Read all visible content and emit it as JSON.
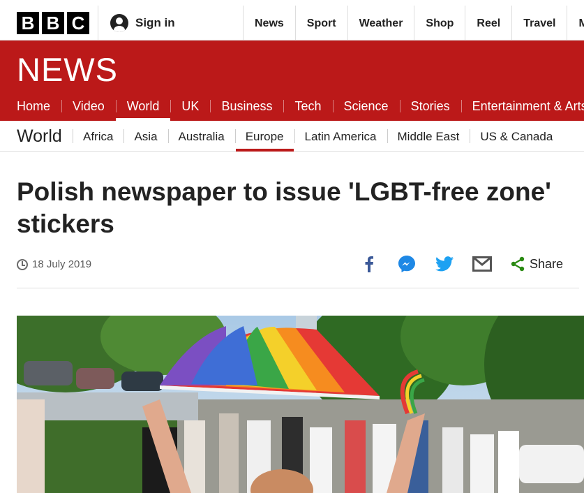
{
  "brand": {
    "logo_letters": [
      "B",
      "B",
      "C"
    ]
  },
  "account": {
    "sign_in_label": "Sign in"
  },
  "top_nav": [
    "News",
    "Sport",
    "Weather",
    "Shop",
    "Reel",
    "Travel",
    "Mo"
  ],
  "banner": {
    "title": "NEWS",
    "color": "#bb1919"
  },
  "main_nav": {
    "items": [
      "Home",
      "Video",
      "World",
      "UK",
      "Business",
      "Tech",
      "Science",
      "Stories",
      "Entertainment & Arts"
    ],
    "active": "World"
  },
  "sub_nav": {
    "section": "World",
    "items": [
      "Africa",
      "Asia",
      "Australia",
      "Europe",
      "Latin America",
      "Middle East",
      "US & Canada"
    ],
    "active": "Europe"
  },
  "article": {
    "headline": "Polish newspaper to issue 'LGBT-free zone' stickers",
    "date": "18 July 2019"
  },
  "share": {
    "label": "Share",
    "icons": [
      "facebook-icon",
      "messenger-icon",
      "twitter-icon",
      "email-icon",
      "share-icon"
    ]
  }
}
